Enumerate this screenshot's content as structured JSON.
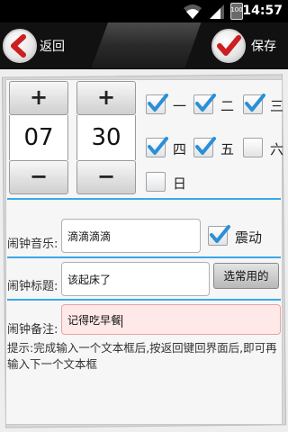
{
  "status_bar": {
    "time": "14:57",
    "battery_label": "100",
    "icons": [
      "wifi-icon",
      "signal-icon",
      "battery-icon"
    ]
  },
  "titlebar": {
    "back_label": "返回",
    "save_label": "保存",
    "back_icon": "chevron-left-icon",
    "save_icon": "checkmark-icon",
    "accent_color": "#cc1f1f"
  },
  "time_picker": {
    "hour": "07",
    "minute": "30",
    "plus": "+",
    "minus": "−"
  },
  "weekdays": [
    {
      "label": "一",
      "checked": true
    },
    {
      "label": "二",
      "checked": true
    },
    {
      "label": "三",
      "checked": true
    },
    {
      "label": "四",
      "checked": true
    },
    {
      "label": "五",
      "checked": true
    },
    {
      "label": "六",
      "checked": false
    },
    {
      "label": "日",
      "checked": false
    }
  ],
  "form": {
    "music_label": "闹钟音乐:",
    "music_value": "滴滴滴滴",
    "vibrate_label": "震动",
    "vibrate_checked": true,
    "title_label": "闹钟标题:",
    "title_value": "该起床了",
    "pick_common_label": "选常用的",
    "note_label": "闹钟备注:",
    "note_value": "记得吃早餐"
  },
  "tip": "提示:完成输入一个文本框后,按返回键回界面后,即可再输入下一个文本框",
  "colors": {
    "divider": "#3aa8e6",
    "check": "#2a8fd8",
    "focused_field_bg": "#ffe8e8"
  }
}
